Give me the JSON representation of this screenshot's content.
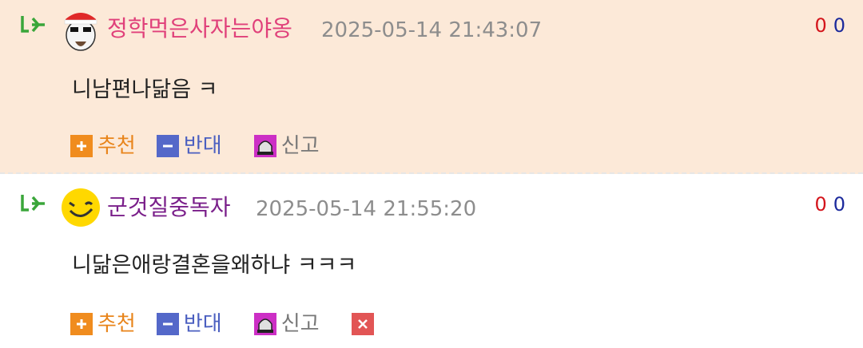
{
  "comments": [
    {
      "nickname": "정학먹은사자는야옹",
      "date": "2025-05-14 21:43:07",
      "upvotes": "0",
      "downvotes": "0",
      "text": "니남편나닮음 ㅋ",
      "recommend_label": "추천",
      "oppose_label": "반대",
      "report_label": "신고",
      "avatar_icon": "santa-hat-character-icon"
    },
    {
      "nickname": "군것질중독자",
      "date": "2025-05-14 21:55:20",
      "upvotes": "0",
      "downvotes": "0",
      "text": "니닮은애랑결혼을왜하냐 ㅋㅋㅋ",
      "recommend_label": "추천",
      "oppose_label": "반대",
      "report_label": "신고",
      "avatar_icon": "winking-smiley-icon"
    }
  ],
  "colors": {
    "highlight_bg": "#fce9d8",
    "recommend": "#f08c1e",
    "oppose": "#5468c9",
    "report": "#cc2fc5",
    "delete": "#e25555"
  },
  "icons": {
    "reply": "reply-arrow-icon",
    "recommend": "plus-icon",
    "oppose": "minus-icon",
    "report": "siren-icon",
    "delete": "close-icon"
  }
}
